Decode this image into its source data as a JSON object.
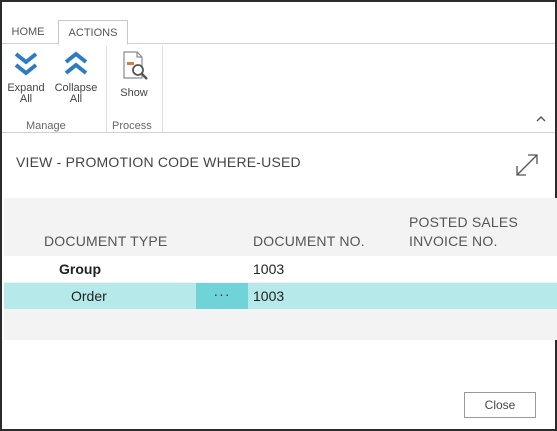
{
  "ribbon": {
    "tabs": [
      {
        "label": "HOME"
      },
      {
        "label": "ACTIONS"
      }
    ],
    "buttons": {
      "expand_all": {
        "line1": "Expand",
        "line2": "All"
      },
      "collapse_all": {
        "line1": "Collapse",
        "line2": "All"
      },
      "show": {
        "label": "Show"
      }
    },
    "groups": {
      "manage": "Manage",
      "process": "Process"
    },
    "collapse_caret": "^"
  },
  "page": {
    "title": "VIEW - PROMOTION CODE WHERE-USED"
  },
  "table": {
    "columns": {
      "document_type": "DOCUMENT TYPE",
      "document_no": "DOCUMENT NO.",
      "posted_sales_invoice_line1": "POSTED SALES",
      "posted_sales_invoice_line2": "INVOICE NO."
    },
    "rows": [
      {
        "document_type": "Group",
        "document_no": "1003",
        "posted_sales_invoice_no": ""
      },
      {
        "document_type": "Order",
        "document_no": "1003",
        "posted_sales_invoice_no": "",
        "selected": true,
        "actions_label": "···"
      }
    ]
  },
  "footer": {
    "close_label": "Close"
  },
  "colors": {
    "accent_blue": "#2b7cc4",
    "selected_row": "#b5e9ea",
    "dots_cell": "#6fd3d7",
    "table_bg": "#f3f3f3"
  },
  "icons": [
    "expand-all-icon",
    "collapse-all-icon",
    "show-icon",
    "expand-window-icon"
  ]
}
